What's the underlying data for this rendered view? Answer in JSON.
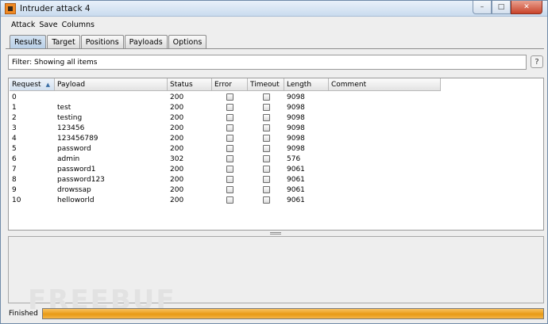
{
  "window": {
    "title": "Intruder attack 4",
    "controls": [
      "minimize",
      "maximize",
      "close"
    ]
  },
  "menu": [
    "Attack",
    "Save",
    "Columns"
  ],
  "tabs": [
    {
      "label": "Results",
      "active": true
    },
    {
      "label": "Target",
      "active": false
    },
    {
      "label": "Positions",
      "active": false
    },
    {
      "label": "Payloads",
      "active": false
    },
    {
      "label": "Options",
      "active": false
    }
  ],
  "filter": {
    "text": "Filter:  Showing all items",
    "help_label": "?"
  },
  "table": {
    "columns": [
      "Request",
      "Payload",
      "Status",
      "Error",
      "Timeout",
      "Length",
      "Comment"
    ],
    "sorted_column": "Request",
    "sort_direction": "ascending",
    "rows": [
      {
        "request": "0",
        "payload": "",
        "status": "200",
        "error": false,
        "timeout": false,
        "length": "9098",
        "comment": ""
      },
      {
        "request": "1",
        "payload": "test",
        "status": "200",
        "error": false,
        "timeout": false,
        "length": "9098",
        "comment": ""
      },
      {
        "request": "2",
        "payload": "testing",
        "status": "200",
        "error": false,
        "timeout": false,
        "length": "9098",
        "comment": ""
      },
      {
        "request": "3",
        "payload": "123456",
        "status": "200",
        "error": false,
        "timeout": false,
        "length": "9098",
        "comment": ""
      },
      {
        "request": "4",
        "payload": "123456789",
        "status": "200",
        "error": false,
        "timeout": false,
        "length": "9098",
        "comment": ""
      },
      {
        "request": "5",
        "payload": "password",
        "status": "200",
        "error": false,
        "timeout": false,
        "length": "9098",
        "comment": ""
      },
      {
        "request": "6",
        "payload": "admin",
        "status": "302",
        "error": false,
        "timeout": false,
        "length": "576",
        "comment": ""
      },
      {
        "request": "7",
        "payload": "password1",
        "status": "200",
        "error": false,
        "timeout": false,
        "length": "9061",
        "comment": ""
      },
      {
        "request": "8",
        "payload": "password123",
        "status": "200",
        "error": false,
        "timeout": false,
        "length": "9061",
        "comment": ""
      },
      {
        "request": "9",
        "payload": "drowssap",
        "status": "200",
        "error": false,
        "timeout": false,
        "length": "9061",
        "comment": ""
      },
      {
        "request": "10",
        "payload": "helloworld",
        "status": "200",
        "error": false,
        "timeout": false,
        "length": "9061",
        "comment": ""
      }
    ]
  },
  "watermark": "FREEBUF",
  "status": {
    "label": "Finished",
    "progress": 1.0,
    "progress_color": "#f0a020"
  }
}
